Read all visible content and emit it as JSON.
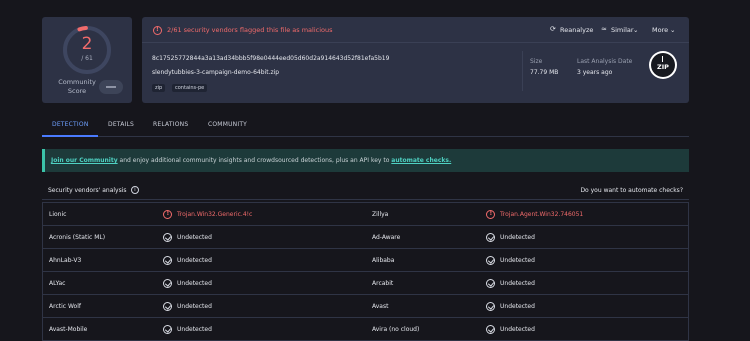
{
  "score": {
    "detections": "2",
    "total": "/ 61",
    "community_label": "Community Score",
    "detection_ratio": 0.0328,
    "accent_color": "#f16b6b"
  },
  "summary": {
    "alert": "2/61 security vendors flagged this file as malicious",
    "actions": {
      "reanalyze": "Reanalyze",
      "similar": "Similar",
      "more": "More"
    },
    "hash": "8c17525772844a3a13ad34bbb5f98e0444eed05d60d2a914643d52f81efa5b19",
    "filename": "slendytubbies-3-campaign-demo-64bit.zip",
    "tags": [
      "zip",
      "contains-pe"
    ],
    "size_label": "Size",
    "size_value": "77.79 MB",
    "last_analysis_label": "Last Analysis Date",
    "last_analysis_value": "3 years ago",
    "file_type_icon": "ZIP"
  },
  "tabs": [
    "DETECTION",
    "DETAILS",
    "RELATIONS",
    "COMMUNITY"
  ],
  "banner": {
    "link1": "Join our Community",
    "text": " and enjoy additional community insights and crowdsourced detections, plus an API key to ",
    "link2": "automate checks."
  },
  "vendors": {
    "title": "Security vendors' analysis",
    "automate_question": "Do you want to automate checks?",
    "rows": [
      {
        "left": {
          "name": "Lionic",
          "result": "Trojan.Win32.Generic.4!c",
          "status": "malicious"
        },
        "right": {
          "name": "Zillya",
          "result": "Trojan.Agent.Win32.746051",
          "status": "malicious"
        }
      },
      {
        "left": {
          "name": "Acronis (Static ML)",
          "result": "Undetected",
          "status": "clean"
        },
        "right": {
          "name": "Ad-Aware",
          "result": "Undetected",
          "status": "clean"
        }
      },
      {
        "left": {
          "name": "AhnLab-V3",
          "result": "Undetected",
          "status": "clean"
        },
        "right": {
          "name": "Alibaba",
          "result": "Undetected",
          "status": "clean"
        }
      },
      {
        "left": {
          "name": "ALYac",
          "result": "Undetected",
          "status": "clean"
        },
        "right": {
          "name": "Arcabit",
          "result": "Undetected",
          "status": "clean"
        }
      },
      {
        "left": {
          "name": "Arctic Wolf",
          "result": "Undetected",
          "status": "clean"
        },
        "right": {
          "name": "Avast",
          "result": "Undetected",
          "status": "clean"
        }
      },
      {
        "left": {
          "name": "Avast-Mobile",
          "result": "Undetected",
          "status": "clean"
        },
        "right": {
          "name": "Avira (no cloud)",
          "result": "Undetected",
          "status": "clean"
        }
      }
    ]
  }
}
